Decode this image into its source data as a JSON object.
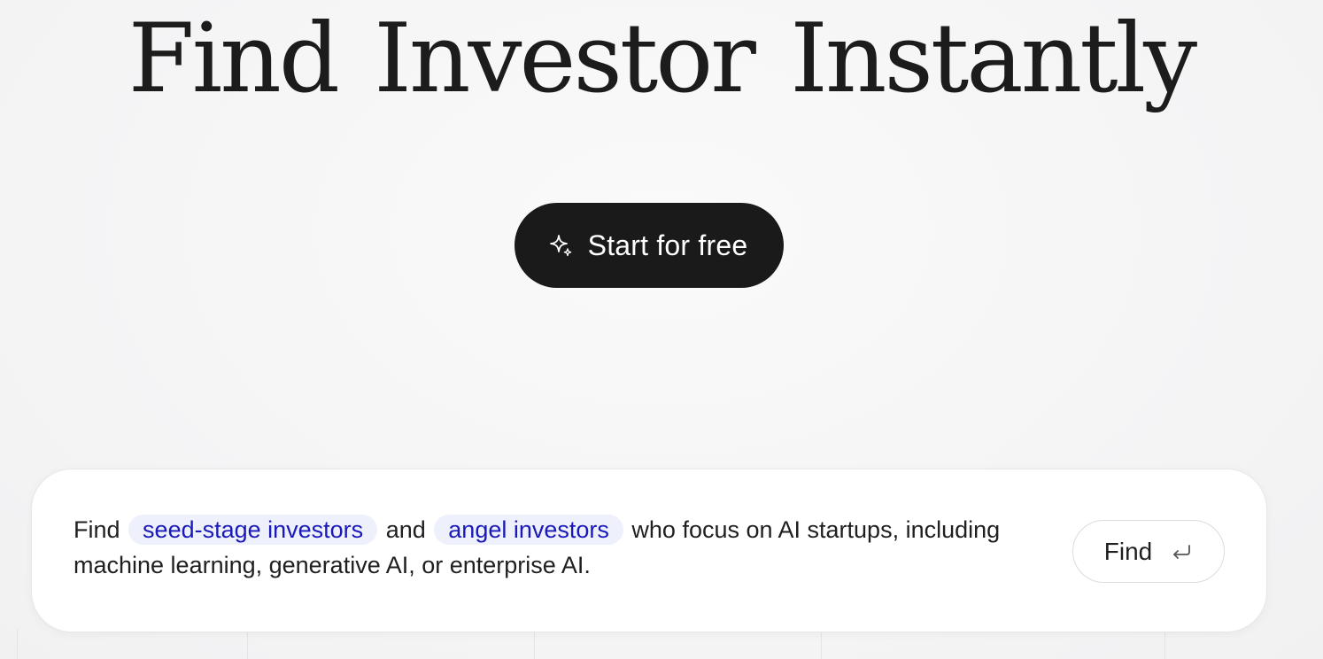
{
  "hero": {
    "title": "Find Investor Instantly"
  },
  "cta": {
    "label": "Start for free",
    "icon": "sparkle-icon",
    "background": "#1a1a1a",
    "text_color": "#ffffff"
  },
  "prompt": {
    "prefix": "Find",
    "chip1": "seed-stage investors",
    "connector": "and",
    "chip2": "angel investors",
    "suffix": "who focus on AI startups, including machine learning, generative AI, or enterprise AI.",
    "chip_color": "#1a1ab8",
    "chip_background": "#eef0fb"
  },
  "find_button": {
    "label": "Find",
    "icon": "enter-key-icon"
  }
}
